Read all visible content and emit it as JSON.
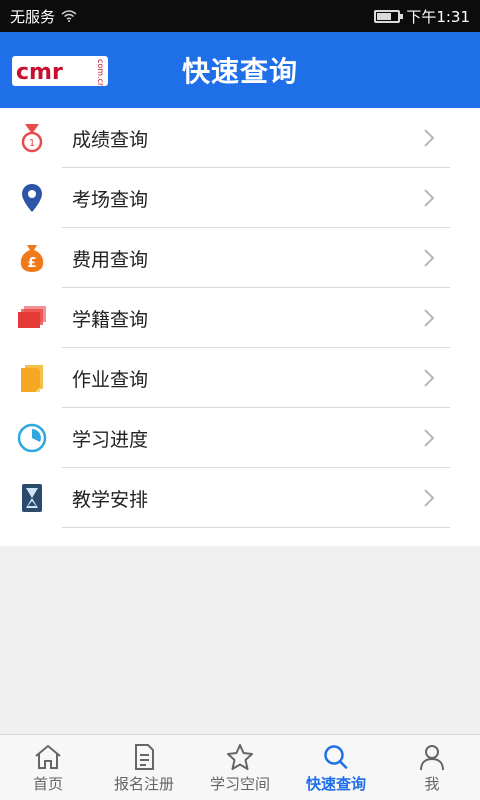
{
  "status_bar": {
    "carrier": "无服务",
    "time": "下午1:31",
    "battery_level": 0.7
  },
  "header": {
    "logo_text": "cmr",
    "logo_suffix": "com.cn",
    "title": "快速查询"
  },
  "menu": {
    "items": [
      {
        "label": "成绩查询",
        "icon": "medal-icon"
      },
      {
        "label": "考场查询",
        "icon": "location-pin-icon"
      },
      {
        "label": "费用查询",
        "icon": "money-bag-icon"
      },
      {
        "label": "学籍查询",
        "icon": "cards-stack-icon"
      },
      {
        "label": "作业查询",
        "icon": "document-icon"
      },
      {
        "label": "学习进度",
        "icon": "progress-circle-icon"
      },
      {
        "label": "教学安排",
        "icon": "hourglass-icon"
      }
    ]
  },
  "tabs": [
    {
      "label": "首页",
      "icon": "home-icon",
      "active": false
    },
    {
      "label": "报名注册",
      "icon": "form-icon",
      "active": false
    },
    {
      "label": "学习空间",
      "icon": "star-icon",
      "active": false
    },
    {
      "label": "快速查询",
      "icon": "search-icon",
      "active": true
    },
    {
      "label": "我",
      "icon": "person-icon",
      "active": false
    }
  ],
  "colors": {
    "accent": "#1e6fe8",
    "status_bar": "#0c0c0c",
    "active_tab": "#1e6fe8"
  }
}
